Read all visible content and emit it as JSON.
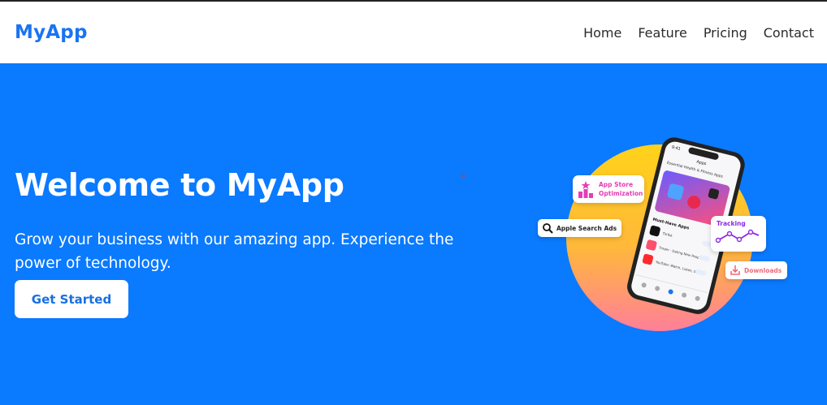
{
  "nav": {
    "brand": "MyApp",
    "links": [
      "Home",
      "Feature",
      "Pricing",
      "Contact"
    ]
  },
  "hero": {
    "title": "Welcome to MyApp",
    "subtitle": "Grow your business with our amazing app. Experience the power of technology.",
    "cta_label": "Get Started"
  },
  "illustration": {
    "tags": {
      "aso_line1": "App Store",
      "aso_line2": "Optimization",
      "search_ads": "Apple Search Ads",
      "tracking": "Tracking",
      "downloads": "Downloads"
    },
    "phone": {
      "status_time": "9:41",
      "header": "Apps",
      "banner_title": "Essential Health & Fitness Apps",
      "section_title": "Must-Have Apps",
      "apps": [
        "TikTok",
        "Tinder - Dating New People",
        "YouTube: Watch, Listen, Stream"
      ],
      "get_label": "GET"
    }
  },
  "colors": {
    "brand": "#1a74f2",
    "hero_bg": "#0a7aff",
    "cta_text": "#1a6fe0",
    "aso_accent": "#e53db5",
    "tracking_accent": "#8a2be2",
    "downloads_accent": "#ef6a7a"
  }
}
